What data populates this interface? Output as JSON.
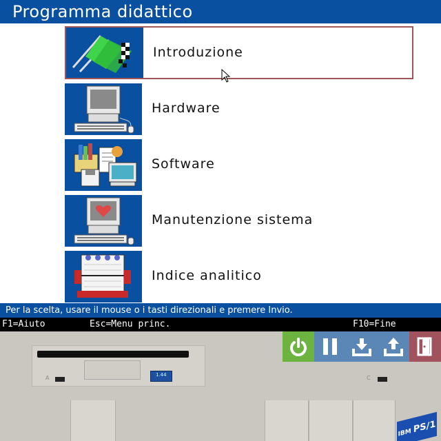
{
  "window": {
    "title": "Programma didattico"
  },
  "menu": {
    "items": [
      {
        "label": "Introduzione",
        "icon": "racing-flags-icon"
      },
      {
        "label": "Hardware",
        "icon": "computer-icon"
      },
      {
        "label": "Software",
        "icon": "software-files-icon"
      },
      {
        "label": "Manutenzione sistema",
        "icon": "computer-heart-icon"
      },
      {
        "label": "Indice analitico",
        "icon": "rolodex-icon"
      }
    ],
    "selected": "Introduzione"
  },
  "status": {
    "text": "Per la scelta, usare il mouse o i tasti direzionali e premere Invio."
  },
  "fkeys": {
    "help": "F1=Aiuto",
    "menu": "Esc=Menu princ.",
    "end": "F10=Fine"
  },
  "machine": {
    "label_a": "A",
    "label_c": "C",
    "brand_ibm": "IBM",
    "brand_ps1": "PS/1",
    "button_label": "1.44"
  },
  "controls": [
    {
      "name": "power",
      "color": "#6cb33f"
    },
    {
      "name": "pause",
      "color": "#5b87b6"
    },
    {
      "name": "download",
      "color": "#5b87b6"
    },
    {
      "name": "upload",
      "color": "#5b87b6"
    },
    {
      "name": "exit",
      "color": "#a0535d"
    }
  ]
}
